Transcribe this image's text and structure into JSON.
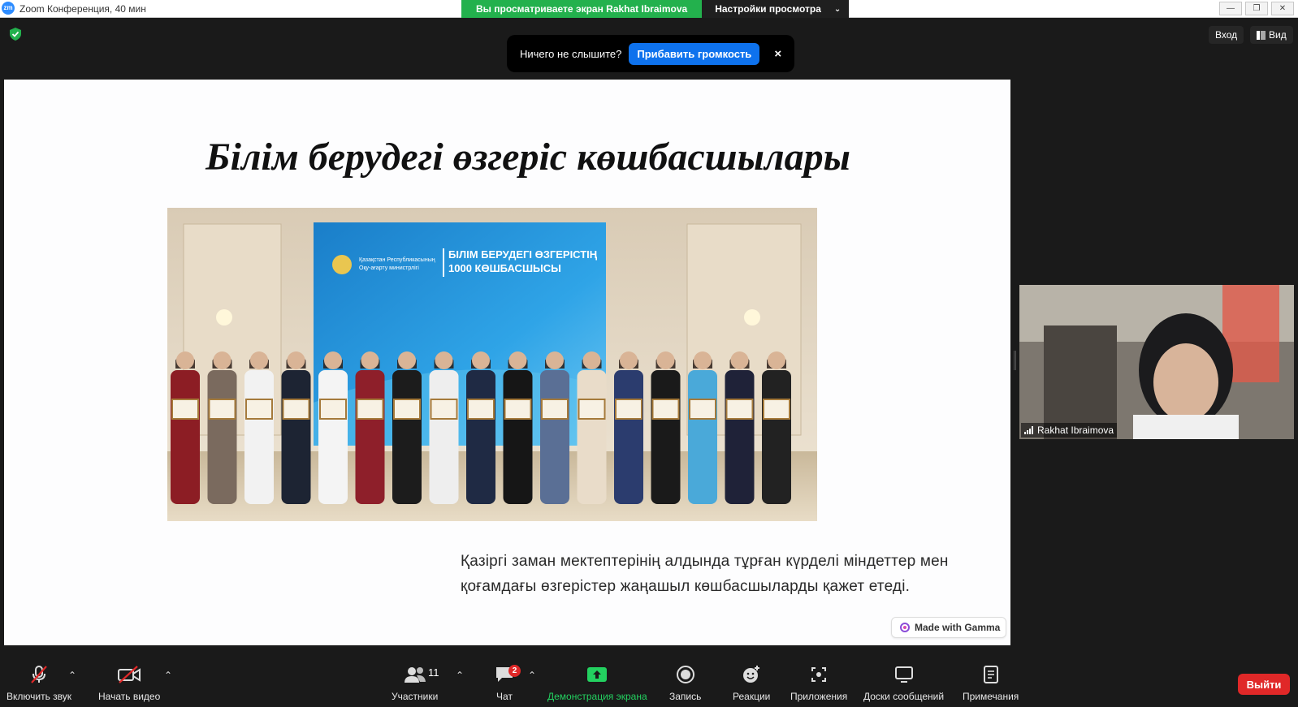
{
  "window": {
    "title": "Zoom Конференция, 40 мин",
    "logo_text": "zm",
    "share_banner": "Вы просматриваете экран Rakhat Ibraimova",
    "view_settings": "Настройки просмотра"
  },
  "top_right": {
    "signin": "Вход",
    "view": "Вид"
  },
  "toast": {
    "message": "Ничего не слышите?",
    "button": "Прибавить громкость",
    "close": "×"
  },
  "slide": {
    "title": "Білім берудегі өзгеріс көшбасшылары",
    "photo": {
      "ministry_line1": "Қазақстан Республикасының",
      "ministry_line2": "Оқу-ағарту министрлігі",
      "banner_line1": "БІЛІМ БЕРУДЕГІ ӨЗГЕРІСТІҢ",
      "banner_line2": "1000 КӨШБАСШЫСЫ"
    },
    "body_line1": "Қазіргі заман мектептерінің алдында тұрған күрделі міндеттер мен",
    "body_line2": "қоғамдағы өзгерістер жаңашыл көшбасшыларды қажет етеді.",
    "gamma_badge": "Made with Gamma"
  },
  "participant": {
    "name": "Rakhat Ibraimova"
  },
  "toolbar": {
    "unmute": "Включить звук",
    "start_video": "Начать видео",
    "participants": "Участники",
    "participants_count": "11",
    "chat": "Чат",
    "chat_badge": "2",
    "share_screen": "Демонстрация экрана",
    "record": "Запись",
    "reactions": "Реакции",
    "apps": "Приложения",
    "whiteboards": "Доски сообщений",
    "notes": "Примечания",
    "leave": "Выйти"
  },
  "colors": {
    "banner_green": "#23b14d",
    "accent_blue": "#0e72ed",
    "leave_red": "#e02828",
    "share_green": "#23d160"
  }
}
